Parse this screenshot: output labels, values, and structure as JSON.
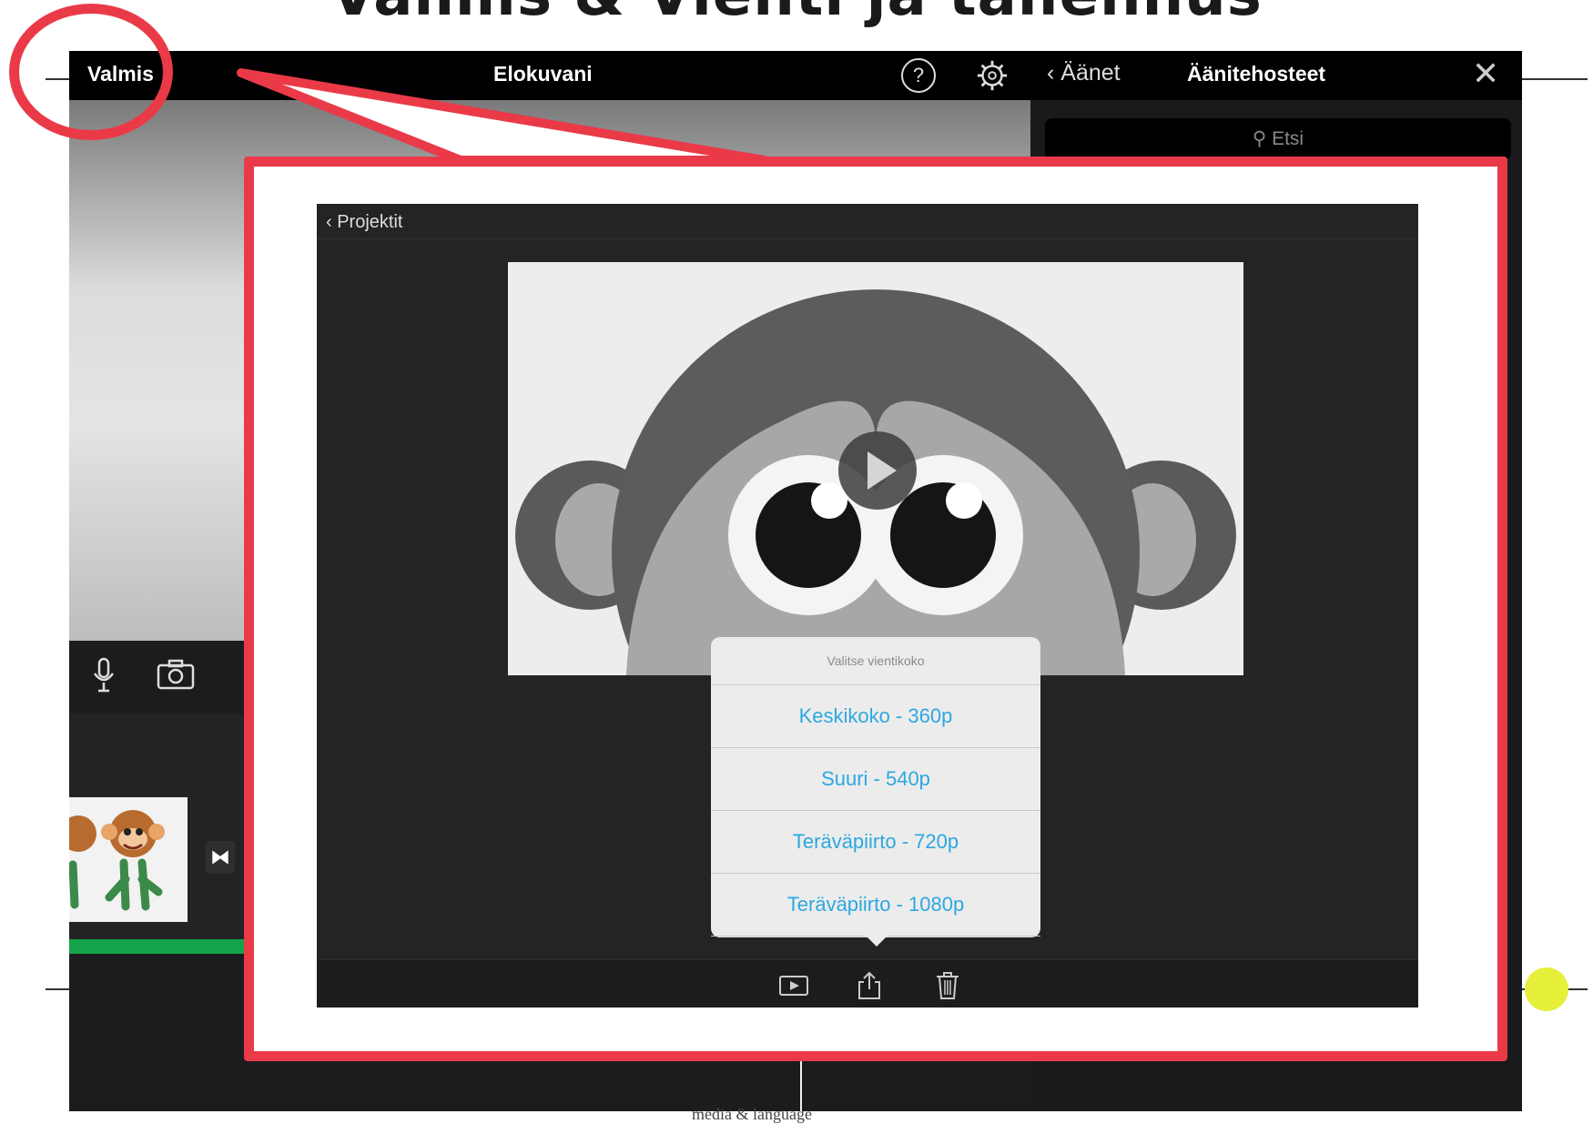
{
  "slide": {
    "title": "Valmis & Vienti ja tallennus",
    "footer": "media & language"
  },
  "app": {
    "done_label": "Valmis",
    "project_title": "Elokuvani",
    "help_symbol": "?",
    "side_panel": {
      "back_label": "Äänet",
      "title": "Äänitehosteet",
      "close_symbol": "✕",
      "search_placeholder": "Etsi"
    },
    "transition_symbol": "⧓"
  },
  "inner": {
    "back_label": "Projektit",
    "export_menu": {
      "title": "Valitse vientikoko",
      "options": [
        "Keskikoko - 360p",
        "Suuri - 540p",
        "Teräväpiirto - 720p",
        "Teräväpiirto - 1080p"
      ]
    }
  },
  "colors": {
    "annotation_red": "#ea3a48",
    "timeline_green": "#14a34a",
    "option_blue": "#2da8e0",
    "marker_yellow": "#e6ef3a"
  }
}
